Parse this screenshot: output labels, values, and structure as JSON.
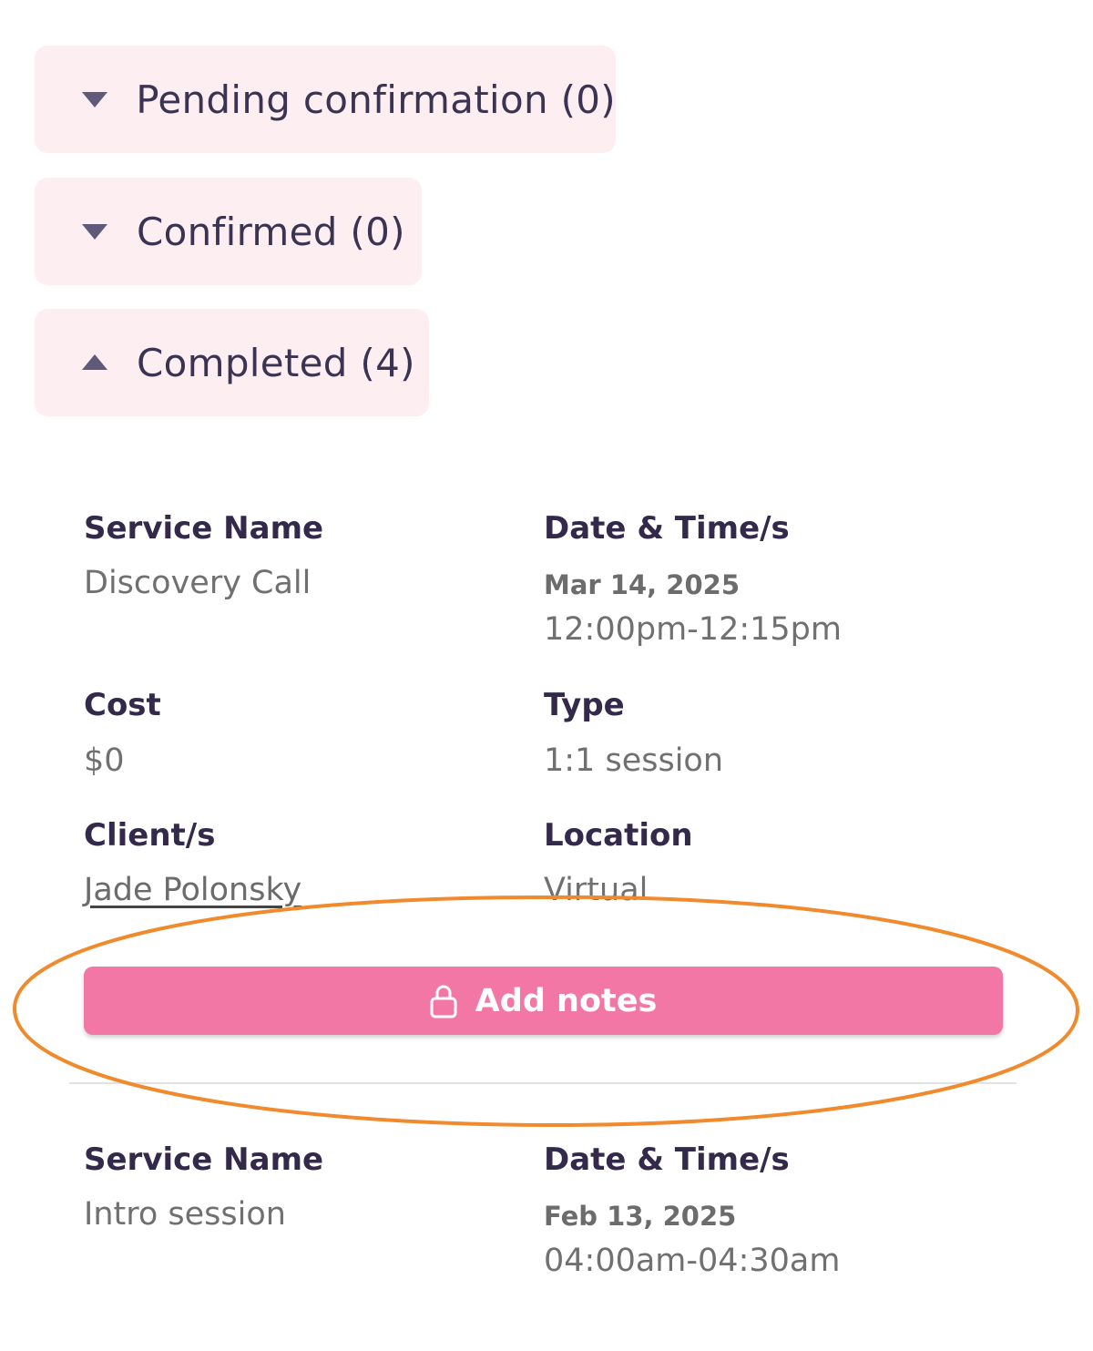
{
  "accordions": [
    {
      "label": "Pending confirmation (0)",
      "expanded": false,
      "icon": "caret-down-icon"
    },
    {
      "label": "Confirmed (0)",
      "expanded": false,
      "icon": "caret-down-icon"
    },
    {
      "label": "Completed (4)",
      "expanded": true,
      "icon": "caret-up-icon"
    }
  ],
  "bookings": [
    {
      "service_label": "Service Name",
      "service_value": "Discovery Call",
      "datetime_label": "Date & Time/s",
      "date": "Mar 14, 2025",
      "time": "12:00pm-12:15pm",
      "cost_label": "Cost",
      "cost_value": "$0",
      "type_label": "Type",
      "type_value": "1:1 session",
      "client_label": "Client/s",
      "client_value": "Jade Polonsky",
      "location_label": "Location",
      "location_value": "Virtual",
      "notes_button": "Add notes"
    },
    {
      "service_label": "Service Name",
      "service_value": "Intro session",
      "datetime_label": "Date & Time/s",
      "date": "Feb 13, 2025",
      "time": "04:00am-04:30am"
    }
  ],
  "colors": {
    "accordion_bg": "#fdeef2",
    "button_bg": "#f277a4",
    "highlight_ring": "#f08a2c"
  }
}
